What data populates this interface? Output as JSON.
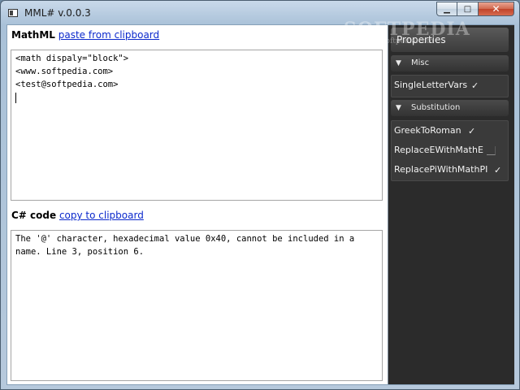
{
  "window": {
    "title": "MML# v.0.0.3"
  },
  "mathml": {
    "label": "MathML",
    "link": "paste from clipboard",
    "content": "<math dispaly=\"block\">\n<www.softpedia.com>\n<test@softpedia.com>\n"
  },
  "csharp": {
    "label": "C# code",
    "link": "copy to clipboard",
    "content": "The '@' character, hexadecimal value 0x40, cannot be included in a name. Line 3, position 6."
  },
  "properties": {
    "title": "Properties",
    "categories": [
      {
        "name": "Misc",
        "items": [
          {
            "label": "SingleLetterVars",
            "checked": true
          }
        ]
      },
      {
        "name": "Substitution",
        "items": [
          {
            "label": "GreekToRoman",
            "checked": true
          },
          {
            "label": "ReplaceEWithMathE",
            "checked": false
          },
          {
            "label": "ReplacePiWithMathPI",
            "checked": true
          }
        ]
      }
    ]
  },
  "watermark": {
    "brand": "SOFTPEDIA",
    "url": "www.softpedia.com"
  },
  "icons": {
    "check": "✓",
    "expanded": "▼",
    "minimize": "minimize-icon",
    "maximize": "maximize-icon",
    "close": "close-icon"
  }
}
